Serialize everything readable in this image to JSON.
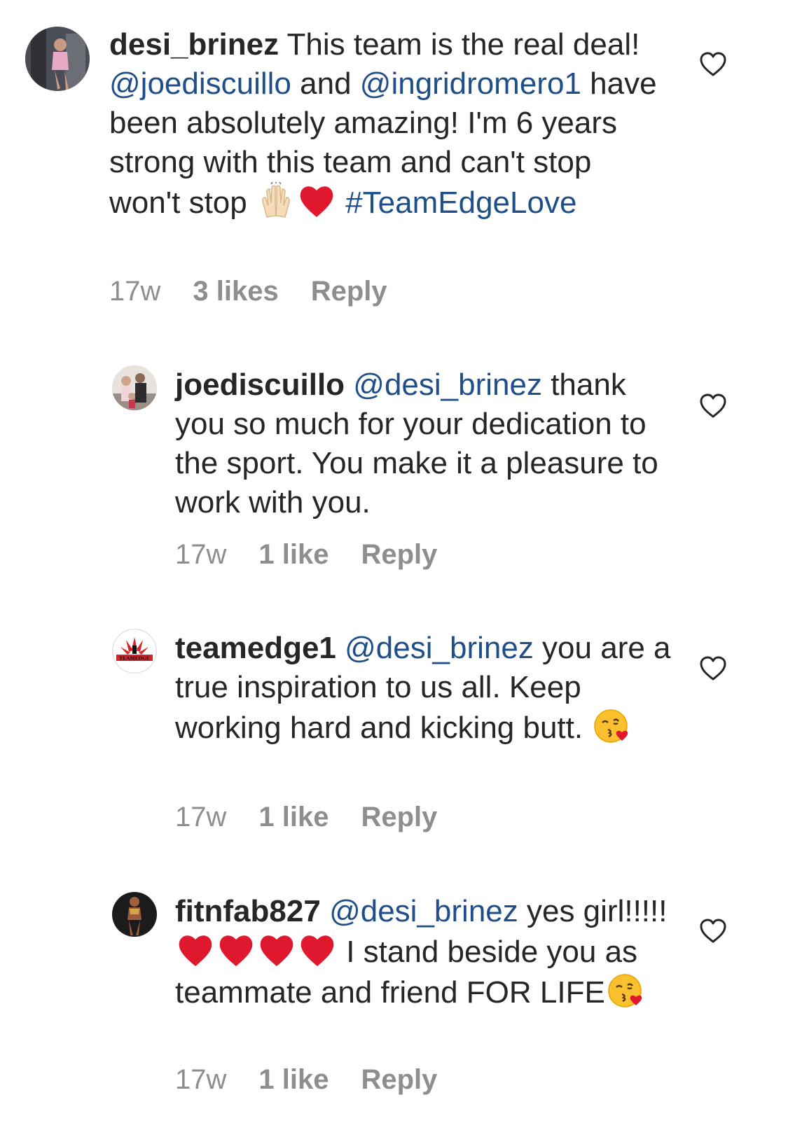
{
  "comments": [
    {
      "username": "desi_brinez",
      "segments": [
        "This team is the real deal! ",
        "@joediscuillo",
        " and ",
        "@ingridromero1",
        " have been absolutely amazing! I'm 6 years strong with this team and can't stop won't stop ",
        "#TeamEdgeLove"
      ],
      "time": "17w",
      "likes": "3 likes",
      "reply": "Reply"
    },
    {
      "username": "joediscuillo",
      "segments": [
        "@desi_brinez",
        " thank you so much for your dedication to the sport. You make it a pleasure to work with you."
      ],
      "time": "17w",
      "likes": "1 like",
      "reply": "Reply"
    },
    {
      "username": "teamedge1",
      "segments": [
        "@desi_brinez",
        " you are a true inspiration to us all. Keep working hard and kicking butt. "
      ],
      "avatar_logo_text": "TEAMEDGE",
      "time": "17w",
      "likes": "1 like",
      "reply": "Reply"
    },
    {
      "username": "fitnfab827",
      "segments": [
        "@desi_brinez",
        " yes girl!!!!! ",
        " I stand beside you as teammate and friend FOR LIFE"
      ],
      "time": "17w",
      "likes": "1 like",
      "reply": "Reply"
    }
  ],
  "colors": {
    "text": "#262626",
    "mention": "#1f4f8a",
    "meta": "#8e8e8e",
    "heart_red": "#e0182d"
  },
  "icons": {
    "like": "heart-outline-icon",
    "emoji_hands": "raising-hands-emoji",
    "emoji_heart": "red-heart-emoji",
    "emoji_kiss": "face-blowing-kiss-emoji"
  }
}
